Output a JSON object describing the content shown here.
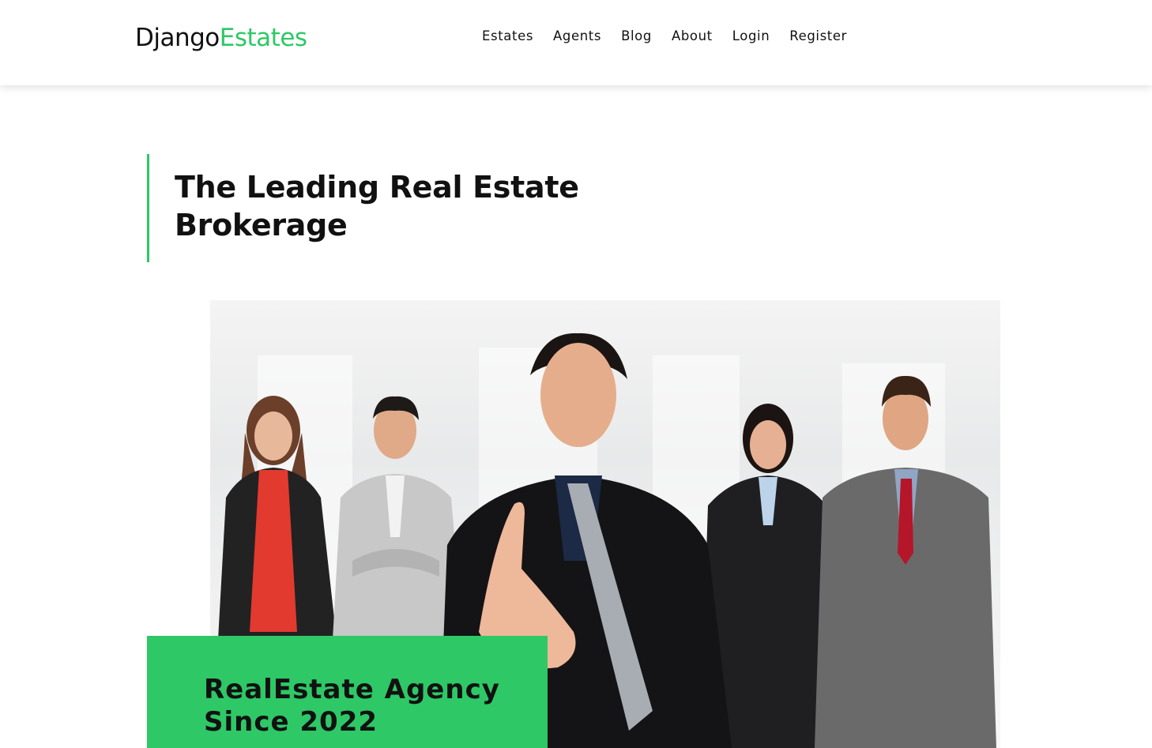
{
  "brand": {
    "name_part1": "Django",
    "name_part2": "Estates",
    "accent_color": "#2ec866"
  },
  "nav": {
    "items": [
      {
        "label": "Estates"
      },
      {
        "label": "Agents"
      },
      {
        "label": "Blog"
      },
      {
        "label": "About"
      },
      {
        "label": "Login"
      },
      {
        "label": "Register"
      }
    ]
  },
  "hero": {
    "headline_line1": "The Leading Real Estate",
    "headline_line2": "Brokerage",
    "image_icon": "team-photo",
    "badge_line1": "RealEstate Agency",
    "badge_line2": "Since 2022"
  }
}
